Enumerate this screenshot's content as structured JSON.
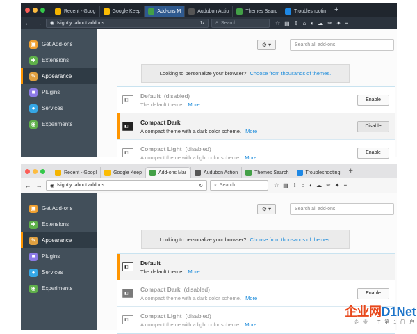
{
  "screens": [
    {
      "theme": "dark",
      "tabs": [
        {
          "label": "Recent - Goog",
          "icon": "google-drive-icon",
          "color": "#f4b400"
        },
        {
          "label": "Google Keep",
          "icon": "keep-icon",
          "color": "#fbbc04"
        },
        {
          "label": "Add-ons M",
          "icon": "puzzle-icon",
          "color": "#43a047"
        },
        {
          "label": "Audubon Actio",
          "icon": "bird-icon",
          "color": "#555555"
        },
        {
          "label": "Themes Searc",
          "icon": "puzzle-icon",
          "color": "#43a047"
        },
        {
          "label": "Troubleshootin",
          "icon": "globe-icon",
          "color": "#1e88e5"
        }
      ],
      "active_tab": 2,
      "identity": "Nightly",
      "url": "about:addons",
      "search_placeholder": "Search",
      "categories": [
        "Get Add-ons",
        "Extensions",
        "Appearance",
        "Plugins",
        "Services",
        "Experiments"
      ],
      "selected_category": 2,
      "addon_search_placeholder": "Search all add-ons",
      "notice_text": "Looking to personalize your browser?",
      "notice_link": "Choose from thousands of themes.",
      "themes": [
        {
          "name": "Default",
          "status": "(disabled)",
          "desc": "The default theme.",
          "more": "More",
          "button": "Enable",
          "active": false,
          "dark": false
        },
        {
          "name": "Compact Dark",
          "status": "",
          "desc": "A compact theme with a dark color scheme.",
          "more": "More",
          "button": "Disable",
          "active": true,
          "dark": true
        },
        {
          "name": "Compact Light",
          "status": "(disabled)",
          "desc": "A compact theme with a light color scheme.",
          "more": "More",
          "button": "Enable",
          "active": false,
          "dark": false
        }
      ]
    },
    {
      "theme": "light",
      "tabs": [
        {
          "label": "Recent - Googl",
          "icon": "google-drive-icon",
          "color": "#f4b400"
        },
        {
          "label": "Google Keep",
          "icon": "keep-icon",
          "color": "#fbbc04"
        },
        {
          "label": "Add-ons Mar",
          "icon": "puzzle-icon",
          "color": "#43a047"
        },
        {
          "label": "Audubon Action",
          "icon": "bird-icon",
          "color": "#555555"
        },
        {
          "label": "Themes Search",
          "icon": "puzzle-icon",
          "color": "#43a047"
        },
        {
          "label": "Troubleshooting",
          "icon": "globe-icon",
          "color": "#1e88e5"
        }
      ],
      "active_tab": 2,
      "identity": "Nightly",
      "url": "about:addons",
      "search_placeholder": "Search",
      "categories": [
        "Get Add-ons",
        "Extensions",
        "Appearance",
        "Plugins",
        "Services",
        "Experiments"
      ],
      "selected_category": 2,
      "addon_search_placeholder": "Search all add-ons",
      "notice_text": "Looking to personalize your browser?",
      "notice_link": "Choose from thousands of themes.",
      "themes": [
        {
          "name": "Default",
          "status": "",
          "desc": "The default theme.",
          "more": "More",
          "button": "",
          "active": true,
          "dark": false
        },
        {
          "name": "Compact Dark",
          "status": "(disabled)",
          "desc": "A compact theme with a dark color scheme.",
          "more": "More",
          "button": "Enable",
          "active": false,
          "dark": true
        },
        {
          "name": "Compact Light",
          "status": "(disabled)",
          "desc": "A compact theme with a light color scheme.",
          "more": "More",
          "button": "",
          "active": false,
          "dark": false
        }
      ]
    }
  ],
  "watermark": {
    "brand": "企业网",
    "brand2": "D1Net",
    "tagline": "企 业 I T 第 1 门 户"
  },
  "colors": {
    "accent": "#ff9500",
    "link": "#1f8ddb",
    "sidebar": "#424f5a"
  }
}
